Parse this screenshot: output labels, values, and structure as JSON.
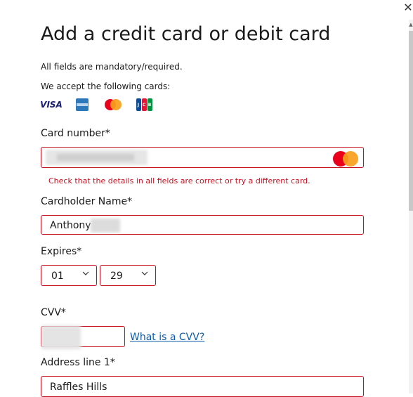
{
  "title": "Add a credit card or debit card",
  "mandatory_note": "All fields are mandatory/required.",
  "accept_note": "We accept the following cards:",
  "cards": [
    {
      "name": "visa-logo",
      "text": "VISA"
    },
    {
      "name": "amex-logo",
      "text": ""
    },
    {
      "name": "mastercard-logo",
      "text": ""
    },
    {
      "name": "jcb-logo",
      "text": "JCB"
    }
  ],
  "card_number": {
    "label": "Card number*",
    "value": "",
    "error": "Check that the details in all fields are correct or try a different card."
  },
  "cardholder": {
    "label": "Cardholder Name*",
    "value": "Anthony"
  },
  "expires": {
    "label": "Expires*",
    "month": "01",
    "year": "29"
  },
  "cvv": {
    "label": "CVV*",
    "value": "",
    "help_link": "What is a CVV?"
  },
  "address1": {
    "label": "Address line 1*",
    "value": "Raffles Hills"
  },
  "colors": {
    "error": "#c50f1f",
    "link": "#0b5cad"
  }
}
